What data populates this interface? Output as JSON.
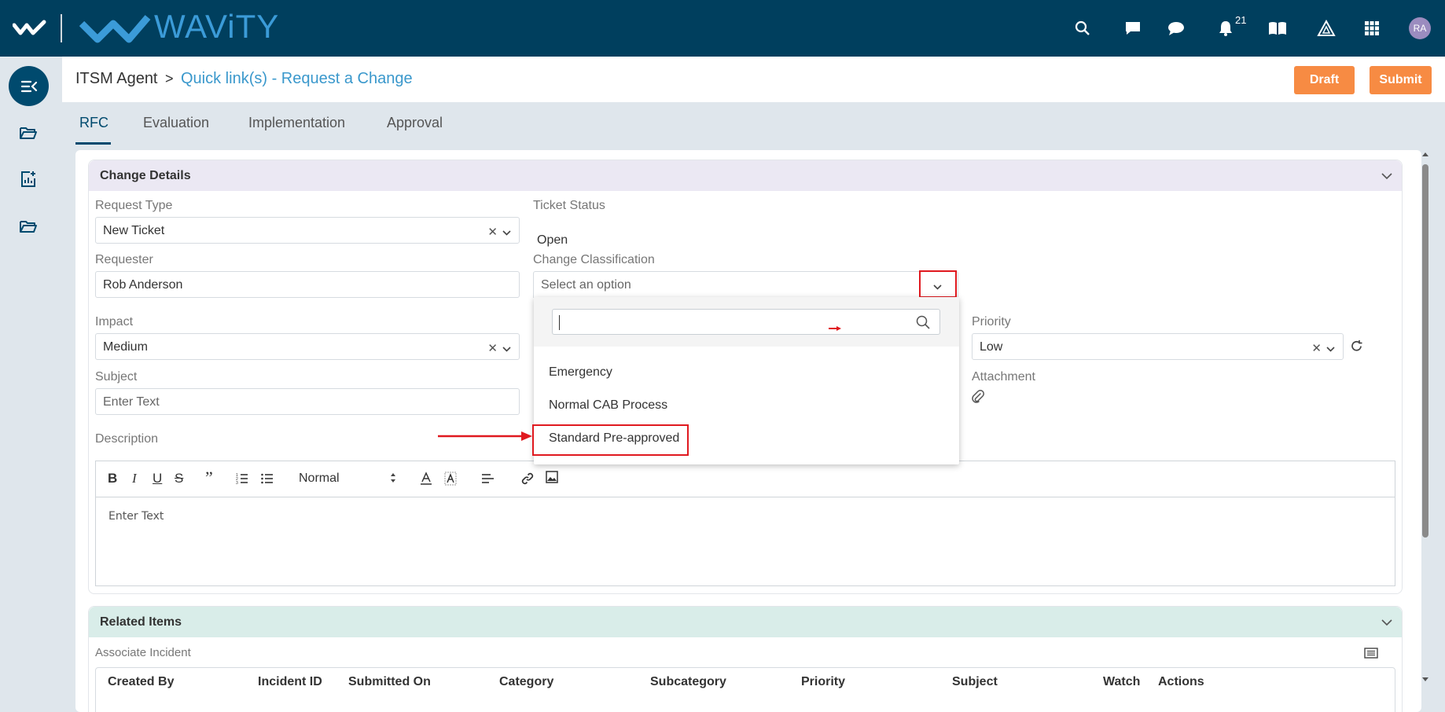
{
  "topbar": {
    "brand": "WAViTY",
    "icons": [
      "search-icon",
      "message-icon",
      "chat-icon",
      "bell-icon",
      "book-icon",
      "triangle-icon",
      "grid-icon"
    ],
    "notification_count": "21",
    "avatar_initials": "RA"
  },
  "sidebar": {
    "items": [
      "collapse-menu-icon",
      "folder-open-icon",
      "report-add-icon",
      "folder-icon"
    ]
  },
  "breadcrumb": {
    "root": "ITSM Agent",
    "separator": ">",
    "current": "Quick link(s) - Request a Change"
  },
  "actions": {
    "draft": "Draft",
    "submit": "Submit"
  },
  "tabs": [
    "RFC",
    "Evaluation",
    "Implementation",
    "Approval"
  ],
  "change_details": {
    "title": "Change Details",
    "request_type": {
      "label": "Request Type",
      "value": "New Ticket"
    },
    "ticket_status": {
      "label": "Ticket Status",
      "value": "Open"
    },
    "requester": {
      "label": "Requester",
      "value": "Rob Anderson"
    },
    "change_classification": {
      "label": "Change Classification",
      "placeholder": "Select an option"
    },
    "impact": {
      "label": "Impact",
      "value": "Medium"
    },
    "priority": {
      "label": "Priority",
      "value": "Low"
    },
    "subject": {
      "label": "Subject",
      "placeholder": "Enter Text"
    },
    "attachment": {
      "label": "Attachment"
    },
    "description": {
      "label": "Description",
      "placeholder": "Enter Text",
      "format": "Normal"
    }
  },
  "dropdown": {
    "options": [
      "Emergency",
      "Normal CAB Process",
      "Standard Pre-approved"
    ]
  },
  "related_items": {
    "title": "Related Items",
    "associate_incident": "Associate Incident",
    "columns": [
      "Created By",
      "Incident ID",
      "Submitted On",
      "Category",
      "Subcategory",
      "Priority",
      "Subject",
      "Watch Lis",
      "Actions"
    ]
  },
  "colors": {
    "topbar": "#003f5e",
    "brand": "#3b9bd8",
    "accent_orange": "#f78b43",
    "highlight_red": "#e0191f"
  }
}
